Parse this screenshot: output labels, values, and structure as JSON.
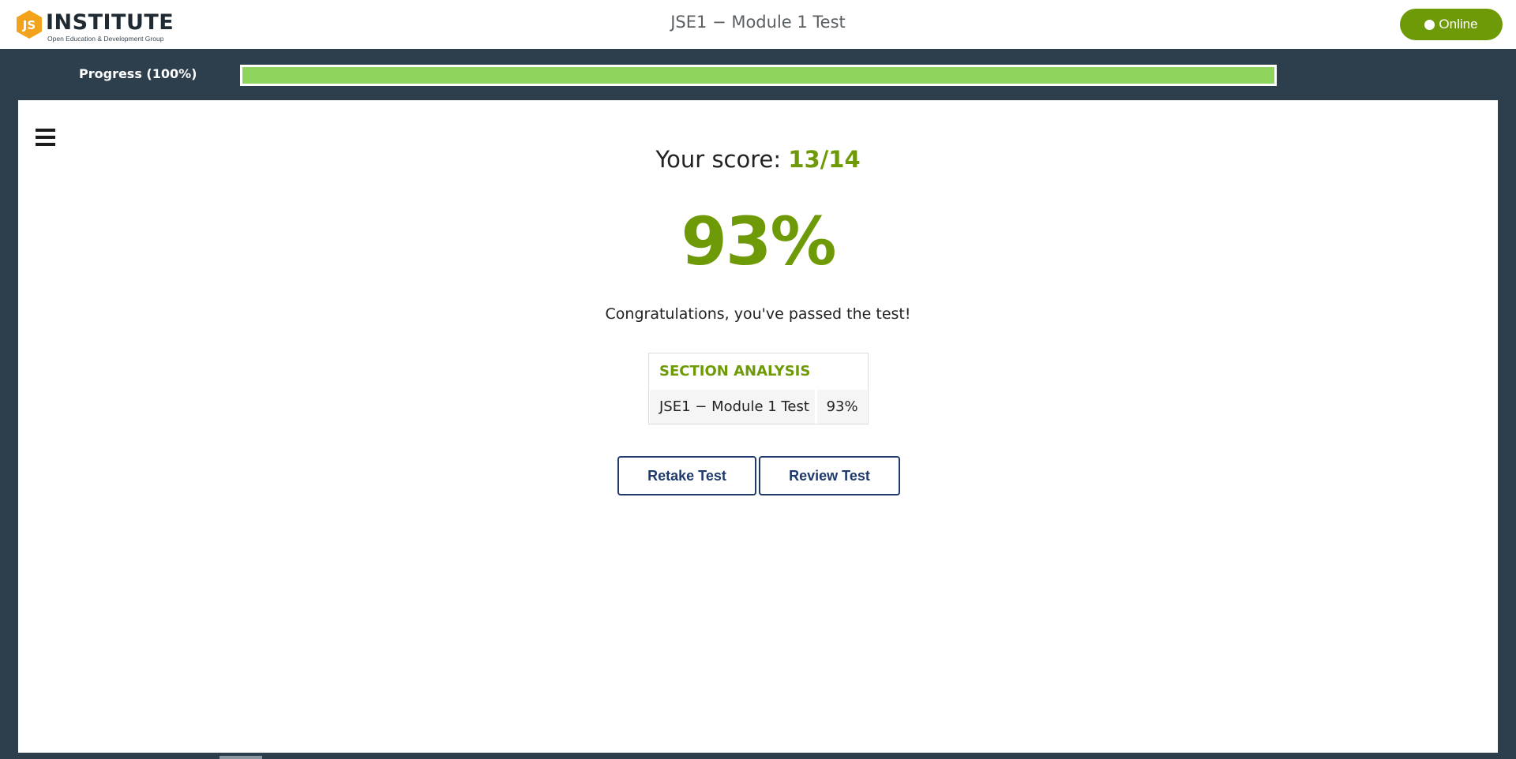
{
  "header": {
    "logo": {
      "badge_text": "JS",
      "word": "INSTITUTE",
      "tagline": "Open Education & Development Group"
    },
    "title": "JSE1 − Module 1 Test",
    "status_label": "Online"
  },
  "progress": {
    "label": "Progress (100%)",
    "value_percent": 100
  },
  "result": {
    "score_prefix": "Your score: ",
    "score_value": "13/14",
    "percent": "93%",
    "message": "Congratulations, you've passed the test!"
  },
  "section_analysis": {
    "heading": "SECTION ANALYSIS",
    "rows": [
      {
        "name": "JSE1 − Module 1 Test",
        "percent": "93%"
      }
    ]
  },
  "actions": {
    "retake_label": "Retake Test",
    "review_label": "Review Test"
  },
  "icons": {
    "menu": "hamburger-menu-icon",
    "status": "status-dot-icon"
  },
  "colors": {
    "brand_green": "#6f9a07",
    "progress_fill": "#8fd45d",
    "page_background": "#2d3e4d",
    "button_border": "#1f3a6b",
    "logo_orange": "#f2a31b"
  }
}
